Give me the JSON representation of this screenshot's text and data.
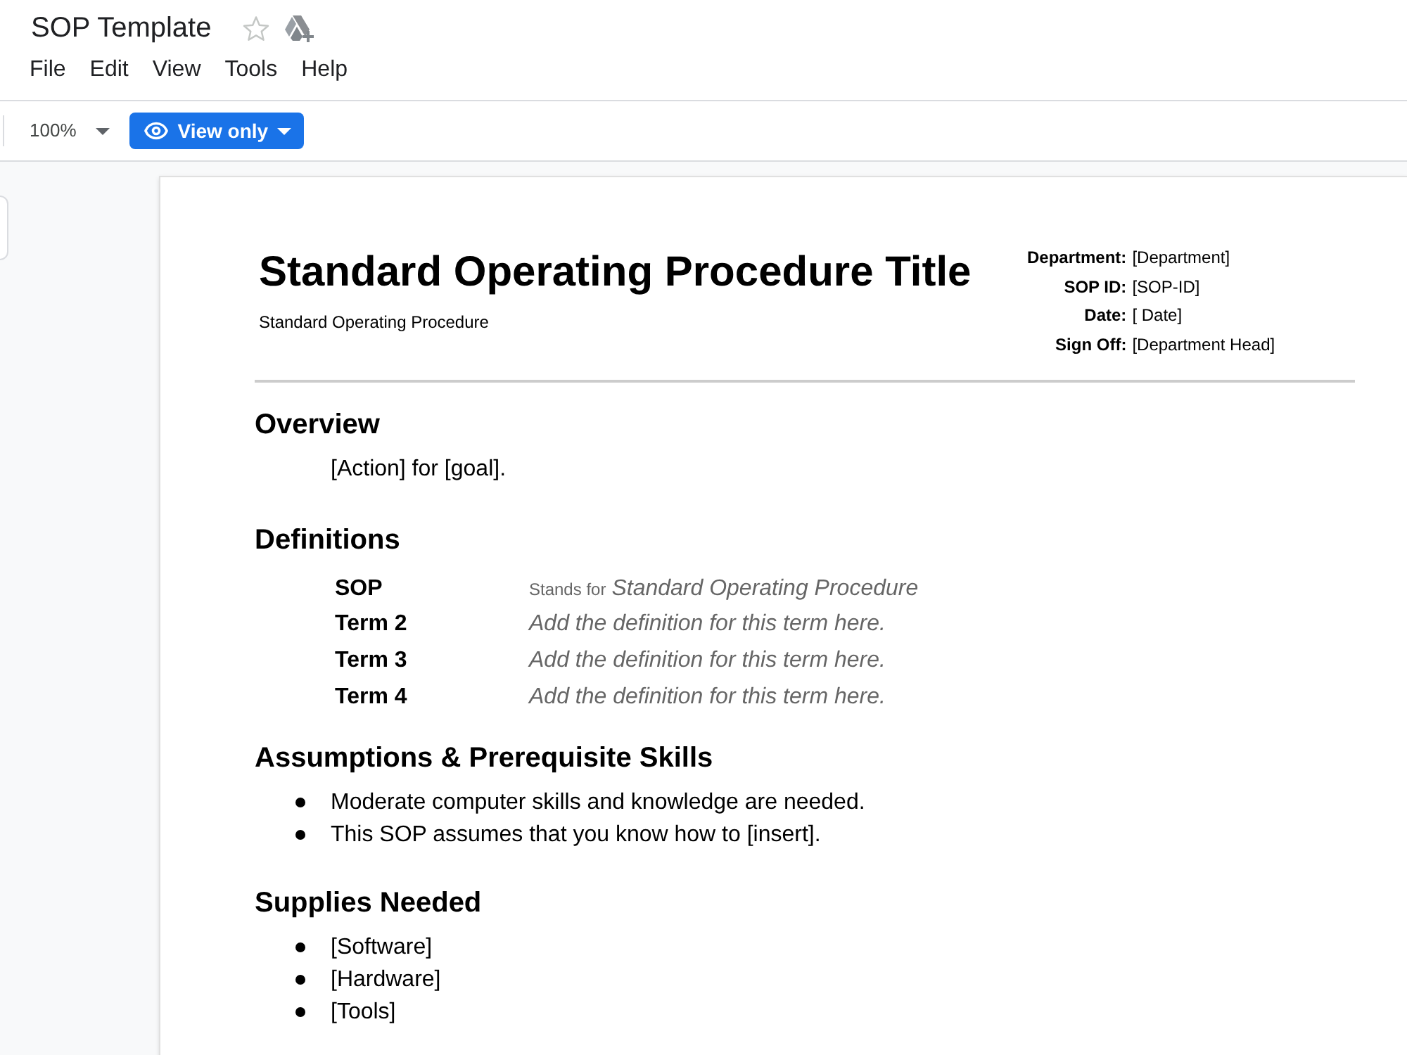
{
  "header": {
    "title": "SOP Template",
    "starred": false
  },
  "menu": [
    "File",
    "Edit",
    "View",
    "Tools",
    "Help"
  ],
  "toolbar": {
    "zoom": "100%",
    "mode_button": "View only"
  },
  "document": {
    "title": "Standard Operating Procedure Title",
    "subtitle": "Standard Operating Procedure",
    "meta": [
      {
        "label": "Department:",
        "value": "[Department]"
      },
      {
        "label": "SOP ID:",
        "value": "[SOP-ID]"
      },
      {
        "label": "Date:",
        "value": "[ Date]"
      },
      {
        "label": "Sign Off:",
        "value": "[Department Head]"
      }
    ],
    "sections": [
      {
        "kind": "paragraph",
        "heading": "Overview",
        "text": "[Action] for [goal]."
      },
      {
        "kind": "definitions",
        "heading": "Definitions",
        "items": [
          {
            "term": "SOP",
            "prefix": "Stands for",
            "definition": "Standard Operating Procedure"
          },
          {
            "term": "Term 2",
            "definition": "Add the definition for this term here."
          },
          {
            "term": "Term 3",
            "definition": "Add the definition for this term here."
          },
          {
            "term": "Term 4",
            "definition": "Add the definition for this term here."
          }
        ]
      },
      {
        "kind": "bullets",
        "heading": "Assumptions & Prerequisite Skills",
        "items": [
          "Moderate computer skills and knowledge are needed.",
          "This SOP assumes that you know how to [insert]."
        ]
      },
      {
        "kind": "bullets",
        "heading": "Supplies Needed",
        "items": [
          "[Software]",
          "[Hardware]",
          "[Tools]"
        ]
      }
    ]
  }
}
